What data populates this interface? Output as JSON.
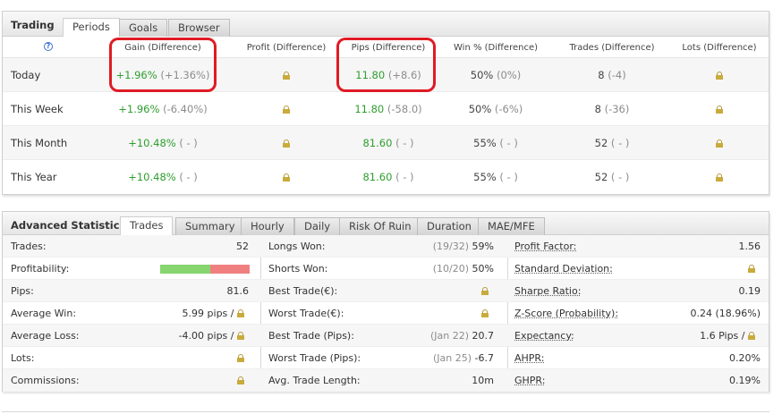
{
  "trading": {
    "title": "Trading",
    "tabs": [
      "Periods",
      "Goals",
      "Browser"
    ],
    "help_glyph": "?",
    "columns": [
      "Gain (Difference)",
      "Profit (Difference)",
      "Pips (Difference)",
      "Win % (Difference)",
      "Trades (Difference)",
      "Lots (Difference)"
    ],
    "rows": [
      {
        "label": "Today",
        "gain": "+1.96%",
        "gain_diff": "(+1.36%)",
        "pips": "11.80",
        "pips_diff": "(+8.6)",
        "win": "50%",
        "win_diff": "(0%)",
        "trades": "8",
        "trades_diff": "(-4)"
      },
      {
        "label": "This Week",
        "gain": "+1.96%",
        "gain_diff": "(-6.40%)",
        "pips": "11.80",
        "pips_diff": "(-58.0)",
        "win": "50%",
        "win_diff": "(-6%)",
        "trades": "8",
        "trades_diff": "(-36)"
      },
      {
        "label": "This Month",
        "gain": "+10.48%",
        "gain_diff": "( - )",
        "pips": "81.60",
        "pips_diff": "( - )",
        "win": "55%",
        "win_diff": "( - )",
        "trades": "52",
        "trades_diff": "( - )"
      },
      {
        "label": "This Year",
        "gain": "+10.48%",
        "gain_diff": "( - )",
        "pips": "81.60",
        "pips_diff": "( - )",
        "win": "55%",
        "win_diff": "( - )",
        "trades": "52",
        "trades_diff": "( - )"
      }
    ]
  },
  "advanced": {
    "title": "Advanced Statistics",
    "tabs": [
      "Trades",
      "Summary",
      "Hourly",
      "Daily",
      "Risk Of Ruin",
      "Duration",
      "MAE/MFE"
    ],
    "profitability_good_fraction": 0.56,
    "col1": {
      "trades_label": "Trades:",
      "trades_value": "52",
      "profitability_label": "Profitability:",
      "pips_label": "Pips:",
      "pips_value": "81.6",
      "avg_win_label": "Average Win:",
      "avg_win_value": "5.99 pips /",
      "avg_loss_label": "Average Loss:",
      "avg_loss_value": "-4.00 pips /",
      "lots_label": "Lots:",
      "commissions_label": "Commissions:"
    },
    "col2": {
      "longs_won_label": "Longs Won:",
      "longs_won_detail": "(19/32)",
      "longs_won_value": "59%",
      "shorts_won_label": "Shorts Won:",
      "shorts_won_detail": "(10/20)",
      "shorts_won_value": "50%",
      "best_trade_eur_label": "Best Trade(€):",
      "worst_trade_eur_label": "Worst Trade(€):",
      "best_trade_pips_label": "Best Trade (Pips):",
      "best_trade_pips_date": "(Jan 22)",
      "best_trade_pips_value": "20.7",
      "worst_trade_pips_label": "Worst Trade (Pips):",
      "worst_trade_pips_date": "(Jan 25)",
      "worst_trade_pips_value": "-6.7",
      "avg_length_label": "Avg. Trade Length:",
      "avg_length_value": "10m"
    },
    "col3": {
      "profit_factor_label": "Profit Factor:",
      "profit_factor_value": "1.56",
      "std_dev_label": "Standard Deviation:",
      "sharpe_label": "Sharpe Ratio:",
      "sharpe_value": "0.19",
      "zscore_label": "Z-Score (Probability):",
      "zscore_value": "0.24 (18.96%)",
      "expectancy_label": "Expectancy:",
      "expectancy_value": "1.6 Pips /",
      "ahpr_label": "AHPR:",
      "ahpr_value": "0.20%",
      "ghpr_label": "GHPR:",
      "ghpr_value": "0.19%"
    }
  },
  "colors": {
    "positive": "#2e9e2e",
    "bar_good": "#86d56e",
    "bar_bad": "#f08080",
    "highlight_circle": "#e01b24",
    "lock": "#c9ab3c"
  }
}
